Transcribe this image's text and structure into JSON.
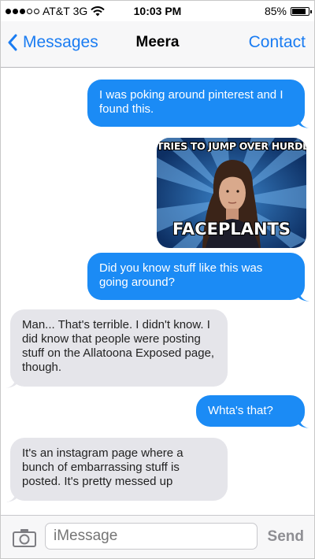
{
  "status_bar": {
    "carrier": "AT&T",
    "network": "3G",
    "time": "10:03 PM",
    "battery": "85%",
    "battery_level": 0.85,
    "signal_bars_filled": 3,
    "signal_bars_total": 5
  },
  "nav": {
    "back_label": "Messages",
    "title": "Meera",
    "contact_label": "Contact"
  },
  "messages": [
    {
      "from": "me",
      "text": "I was poking around pinterest and I found this."
    },
    {
      "from": "me",
      "type": "image",
      "top_text": "TRIES TO JUMP OVER HURDLE",
      "bottom_text": "FACEPLANTS"
    },
    {
      "from": "me",
      "text": "Did you know stuff like this was going around?"
    },
    {
      "from": "them",
      "text": "Man... That's terrible. I didn't know. I did know that people were posting stuff on the Allatoona Exposed page, though."
    },
    {
      "from": "me",
      "text": "Whta's that?"
    },
    {
      "from": "them",
      "text": "It's an instagram page where a bunch of embarrassing stuff is posted. It's pretty messed up"
    }
  ],
  "input": {
    "placeholder": "iMessage",
    "send_label": "Send"
  },
  "colors": {
    "accent": "#1a7cf2",
    "outgoing_bubble": "#1b8bf5",
    "incoming_bubble": "#e5e5ea"
  },
  "icons": {
    "camera": "camera-icon",
    "back": "chevron-left-icon",
    "wifi": "wifi-icon",
    "battery": "battery-icon"
  }
}
